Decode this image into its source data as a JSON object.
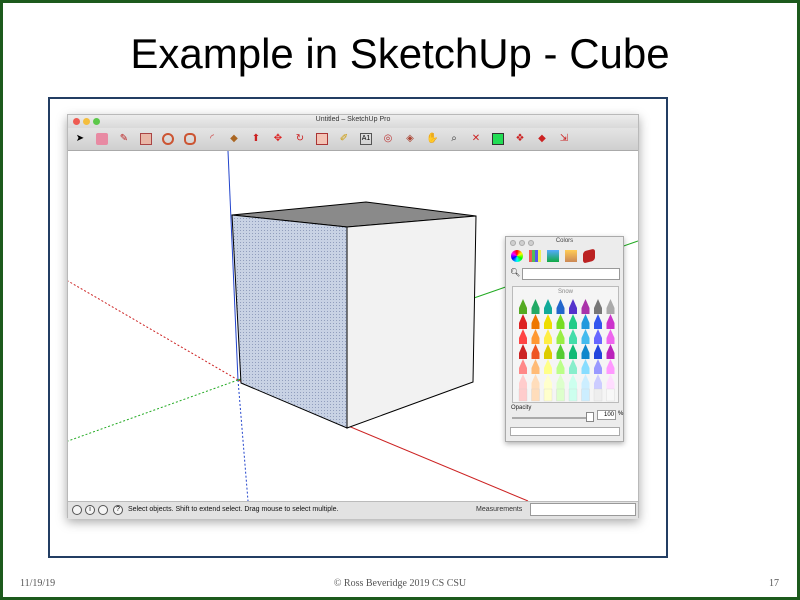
{
  "slide": {
    "title": "Example in SketchUp - Cube",
    "footer_date": "11/19/19",
    "footer_center": "© Ross Beveridge  2019 CS CSU",
    "page_number": "17"
  },
  "window": {
    "title": "Untitled – SketchUp Pro",
    "traffic_lights": [
      "close",
      "minimize",
      "zoom"
    ],
    "toolbar_icons": [
      "select-arrow-icon",
      "eraser-icon",
      "pencil-icon",
      "rectangle-icon",
      "circle-icon",
      "polygon-icon",
      "arc-icon",
      "paint-bucket-icon",
      "push-pull-icon",
      "move-icon",
      "rotate-icon",
      "scale-icon",
      "tape-measure-icon",
      "text-icon",
      "orbit-icon",
      "pan-icon",
      "hand-icon",
      "zoom-icon",
      "zoom-extents-icon",
      "warehouse-icon",
      "components-icon",
      "extension-icon",
      "send-to-layout-icon"
    ]
  },
  "status": {
    "message": "Select objects. Shift to extend select. Drag mouse to select multiple.",
    "measurements_label": "Measurements",
    "measurements_value": ""
  },
  "colors_panel": {
    "title": "Colors",
    "tabs": [
      "color-wheel-icon",
      "color-palettes-icon",
      "image-palettes-icon",
      "color-sliders-icon",
      "crayons-icon"
    ],
    "selected_name": "Snow",
    "opacity_label": "Opacity",
    "opacity_value": "100",
    "opacity_unit": "%"
  },
  "colors": {
    "frame_border": "#233e63",
    "slide_border": "#1d5a1d",
    "axis_red": "#cc2222",
    "axis_green": "#22aa22",
    "axis_blue": "#2244cc",
    "cube_top": "#8a8a8a",
    "cube_left": "#c8d2e4",
    "cube_right": "#f2f2f2"
  }
}
